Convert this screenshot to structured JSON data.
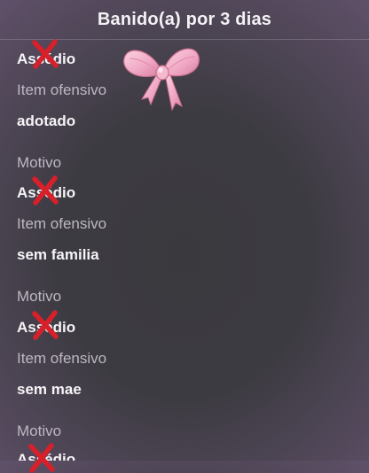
{
  "header": {
    "title": "Banido(a) por 3 dias"
  },
  "entries": [
    {
      "reason_value": "Assédio",
      "item_label": "Item ofensivo",
      "item_value": "adotado"
    },
    {
      "reason_label": "Motivo",
      "reason_value": "Assédio",
      "item_label": "Item ofensivo",
      "item_value": "sem familia"
    },
    {
      "reason_label": "Motivo",
      "reason_value": "Assédio",
      "item_label": "Item ofensivo",
      "item_value": "sem mae"
    },
    {
      "reason_label": "Motivo",
      "reason_value": "Assédio"
    }
  ],
  "decorations": {
    "bow_color": "#f0a9c4",
    "cross_color": "#d8202a",
    "bow_icon": "pink-ribbon-bow",
    "cross_icon": "red-x-mark"
  }
}
